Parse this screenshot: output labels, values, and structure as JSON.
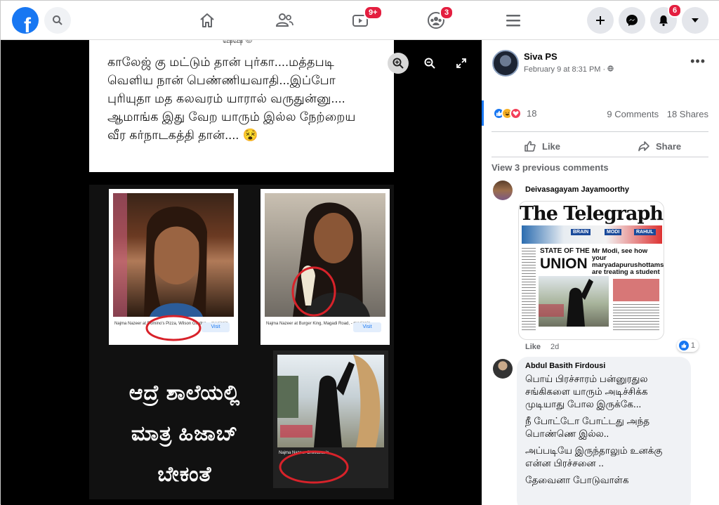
{
  "nav": {
    "badges": {
      "watch": "9+",
      "groups": "3",
      "notifications": "6"
    }
  },
  "post": {
    "tamil_text": "காலேஜ் கு மட்டும் தான் புர்கா....மத்தபடி வெளிய நான் பெண்ணியவாதி...இப்போ புரியுதா மத கலவரம் யாரால் வருதுன்னு.... ஆமாங்க இது வேற யாரும் இல்ல நேற்றைய வீர கர்நாடகத்தி தான்.... 😵",
    "image_captions": {
      "photo1": "Najma Nazeer at Domino's Pizza, Wilson Garden, - magicpin",
      "photo2": "Najma Nazeer at Burger King, Magadi Road, - magicpin",
      "photo3": "Najma Nazeer Chikkarasin",
      "visit": "Visit",
      "source": "magicpin"
    },
    "kannada_lines": [
      "ಆದ್ರೆ ಶಾಲೆಯಲ್ಲಿ",
      "ಮಾತ್ರ ಹಿಜಾಬ್",
      "ಬೇಕಂತೆ"
    ]
  },
  "sidebar": {
    "author": "Siva PS",
    "timestamp": "February 9 at 8:31 PM · ",
    "reaction_count": "18",
    "comments": "9 Comments",
    "shares": "18 Shares",
    "like_label": "Like",
    "share_label": "Share",
    "previous_comments": "View 3 previous comments",
    "comment1": {
      "name": "Deivasagayam Jayamoorthy",
      "newspaper": {
        "title": "The Telegraph",
        "state_of_the": "STATE OF THE",
        "union": "UNION",
        "headline": "Mr Modi, see how your maryadapurushottams are treating a student",
        "tags": [
          "BRAIN",
          "MODI",
          "RAHUL"
        ]
      },
      "like": "Like",
      "time": "2d",
      "like_count": "1"
    },
    "comment2": {
      "name": "Abdul Basith Firdousi",
      "lines": [
        "பொய் பிரச்சாரம் பன்னுரதுல சங்கிகளை யாரும் அடிச்சிக்க முடியாது போல இருக்கே...",
        "நீ போட்டோ போட்டது அந்த பொண்ணெ இல்ல..",
        "அப்படியே இருந்தாலும் உனக்கு என்ன பிரச்சனை ..",
        "தேவைனா போடுவாள்க"
      ]
    }
  },
  "colors": {
    "brand": "#1877f2",
    "badge": "#e41e3f",
    "viewer_bg": "#000000"
  }
}
